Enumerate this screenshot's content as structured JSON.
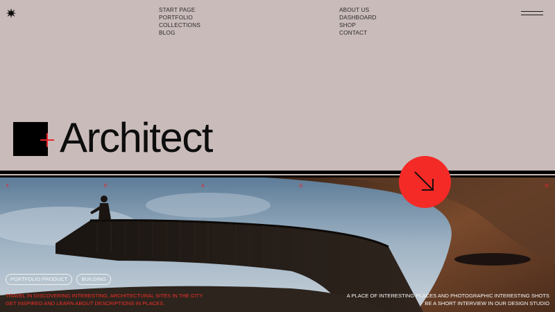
{
  "nav": {
    "left": [
      "START PAGE",
      "PORTFOLIO",
      "COLLECTIONS",
      "BLOG"
    ],
    "right": [
      "ABOUT US",
      "DASHBOARD",
      "SHOP",
      "CONTACT"
    ]
  },
  "hero": {
    "title": "Architect",
    "letters": [
      "X",
      "E",
      "A",
      "G",
      "B"
    ],
    "tags": [
      "PORTFOLIO PRODUCT",
      "BUILDING"
    ],
    "left_text": [
      "TRAVEL IN DISCOVERING INTERESTING, ARCHITECTURAL SITES IN THE CITY",
      "GET INSPIRED AND LEARN ABOUT DESCRIPTIONS IN PLACES."
    ],
    "right_text": [
      "A PLACE OF INTERESTING PLACES AND PHOTOGRAPHIC INTERESTING SHOTS",
      "BE A SHORT INTERVIEW IN OUR DESIGN STUDIO"
    ]
  },
  "icons": {
    "logo": "starburst-icon",
    "menu": "hamburger-icon",
    "cta": "arrow-down-right-icon"
  },
  "colors": {
    "background": "#c9bbba",
    "accent_red": "#f42a27",
    "black": "#000000"
  }
}
